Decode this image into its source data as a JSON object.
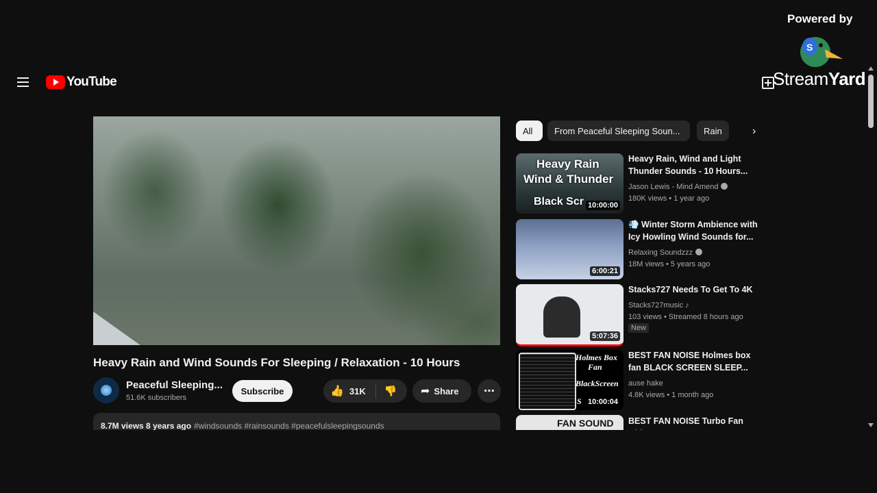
{
  "header": {
    "brand": "YouTube"
  },
  "overlay": {
    "powered_by": "Powered by",
    "brand_light": "Stream",
    "brand_bold": "Yard"
  },
  "video": {
    "title": "Heavy Rain and Wind Sounds For Sleeping / Relaxation - 10 Hours",
    "channel": "Peaceful Sleeping...",
    "subscribers": "51.6K subscribers",
    "subscribe_label": "Subscribe",
    "likes": "31K",
    "share_label": "Share",
    "stats": "8.7M views 8 years ago",
    "tags": "#windsounds #rainsounds #peacefulsleepingsounds"
  },
  "chips": [
    "All",
    "From Peaceful Sleeping Soun...",
    "Rain"
  ],
  "recommended": [
    {
      "title": "Heavy Rain, Wind and Light Thunder Sounds - 10 Hours...",
      "channel": "Jason Lewis - Mind Amend",
      "meta": "180K views • 1 year ago",
      "duration": "10:00:00",
      "thumb_text": [
        "Heavy Rain",
        "Wind & Thunder",
        "Black Scr"
      ]
    },
    {
      "title": "💨 Winter Storm Ambience with Icy Howling Wind Sounds for...",
      "channel": "Relaxing Soundzzz",
      "meta": "18M views • 5 years ago",
      "duration": "6:00:21"
    },
    {
      "title": "Stacks727 Needs To Get To 4K",
      "channel": "Stacks727music ♪",
      "meta": "103 views • Streamed 8 hours ago",
      "badge": "New",
      "duration": "5:07:36"
    },
    {
      "title": "BEST FAN NOISE Holmes box fan BLACK SCREEN SLEEP...",
      "channel": "ause hake",
      "meta": "4.8K views • 1 month ago",
      "duration": "10:00:04",
      "thumb_text": [
        "Holmes Box",
        "Fan",
        "BlackScreen",
        "S"
      ]
    },
    {
      "title": "BEST FAN NOISE Turbo Fan with",
      "thumb_text": "FAN SOUND"
    }
  ],
  "icons": {
    "menu": "menu-icon",
    "add": "create-icon",
    "like": "thumb-up-icon",
    "dislike": "thumb-down-icon",
    "share": "share-icon",
    "more": "more-icon",
    "next": "chevron-right-icon"
  },
  "colors": {
    "background": "#0f0f0f",
    "accent": "#ff0000",
    "chip": "#272727"
  }
}
